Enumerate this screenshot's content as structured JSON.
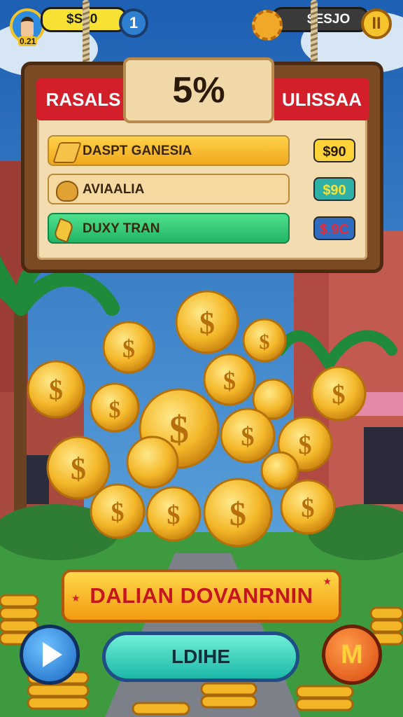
{
  "hud": {
    "player_level": "0.21",
    "coins_left": "$S40",
    "info_button": "1",
    "coins_right": "$ESJO",
    "pause_button": "II"
  },
  "board": {
    "percent": "5%",
    "left_tab": "RASALS",
    "right_tab": "ULISSAA",
    "items": [
      {
        "label": "DASPT GANESIA",
        "icon": "gold-bars-icon",
        "price": "$90",
        "bar_color": "#f6b51e",
        "price_color": "#ffd23a"
      },
      {
        "label": "AVIAALIA",
        "icon": "crest-icon",
        "price": "$90",
        "bar_color": "#f5d9a0",
        "price_color": "#2fb0a6"
      },
      {
        "label": "DUXY TRAN",
        "icon": "crystal-icon",
        "price": "$.9C",
        "bar_color": "#33d07a",
        "price_color": "#2f6cc0"
      }
    ]
  },
  "buttons": {
    "main_label": "DALIAN DOVANRNIN",
    "go_label": "LDIHE",
    "play_icon": "play-icon",
    "m_label": "M"
  },
  "colors": {
    "sky": "#2b7fc9",
    "banner_red": "#d21f2a",
    "gold": "#f2b526",
    "wood": "#7a4a24"
  }
}
